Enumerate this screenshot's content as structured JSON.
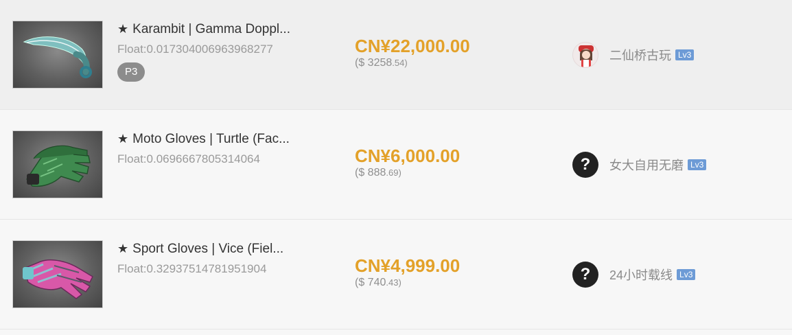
{
  "listings": [
    {
      "name": "Karambit | Gamma Doppl...",
      "float": "Float:0.017304006963968277",
      "phase": "P3",
      "price_cny": "CN¥22,000.00",
      "price_usd_main": "($ 3258",
      "price_usd_cents": ".54)",
      "seller_name": "二仙桥古玩",
      "seller_level": "Lv3",
      "avatar": "anime-avatar",
      "thumb_icon": "karambit-knife-icon"
    },
    {
      "name": "Moto Gloves | Turtle (Fac...",
      "float": "Float:0.0696667805314064",
      "phase": "",
      "price_cny": "CN¥6,000.00",
      "price_usd_main": "($ 888",
      "price_usd_cents": ".69)",
      "seller_name": "女大自用无磨",
      "seller_level": "Lv3",
      "avatar": "?",
      "thumb_icon": "moto-gloves-icon"
    },
    {
      "name": "Sport Gloves | Vice (Fiel...",
      "float": "Float:0.32937514781951904",
      "phase": "",
      "price_cny": "CN¥4,999.00",
      "price_usd_main": "($ 740",
      "price_usd_cents": ".43)",
      "seller_name": "24小时载线",
      "seller_level": "Lv3",
      "avatar": "?",
      "thumb_icon": "sport-gloves-icon"
    }
  ],
  "colors": {
    "price": "#e3a129",
    "level_badge": "#6d9bd6",
    "phase_badge": "#8c8c8c"
  },
  "icons": {
    "star": "★"
  }
}
